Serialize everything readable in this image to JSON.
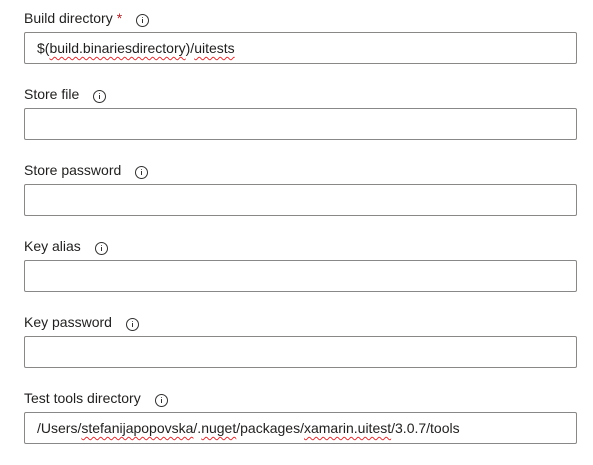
{
  "fields": [
    {
      "label": "Build directory",
      "required_marker": "*",
      "info_icon": "info-icon",
      "value_parts": [
        "$(",
        "build.binariesdirectory",
        ")/",
        "uitests"
      ],
      "placeholder": ""
    },
    {
      "label": "Store file",
      "info_icon": "info-icon",
      "value": "",
      "placeholder": ""
    },
    {
      "label": "Store password",
      "info_icon": "info-icon",
      "value": "",
      "placeholder": ""
    },
    {
      "label": "Key alias",
      "info_icon": "info-icon",
      "value": "",
      "placeholder": ""
    },
    {
      "label": "Key password",
      "info_icon": "info-icon",
      "value": "",
      "placeholder": ""
    },
    {
      "label": "Test tools directory",
      "info_icon": "info-icon",
      "value_parts": [
        "/Users/",
        "stefanijapopovska",
        "/.",
        "nuget",
        "/packages/",
        "xamarin.uitest",
        "/3.0.7/tools"
      ],
      "placeholder": ""
    }
  ],
  "colors": {
    "text": "#201f1e",
    "required": "#a4262c",
    "input_border": "#8a8886",
    "spellcheck_underline": "#d13438"
  }
}
